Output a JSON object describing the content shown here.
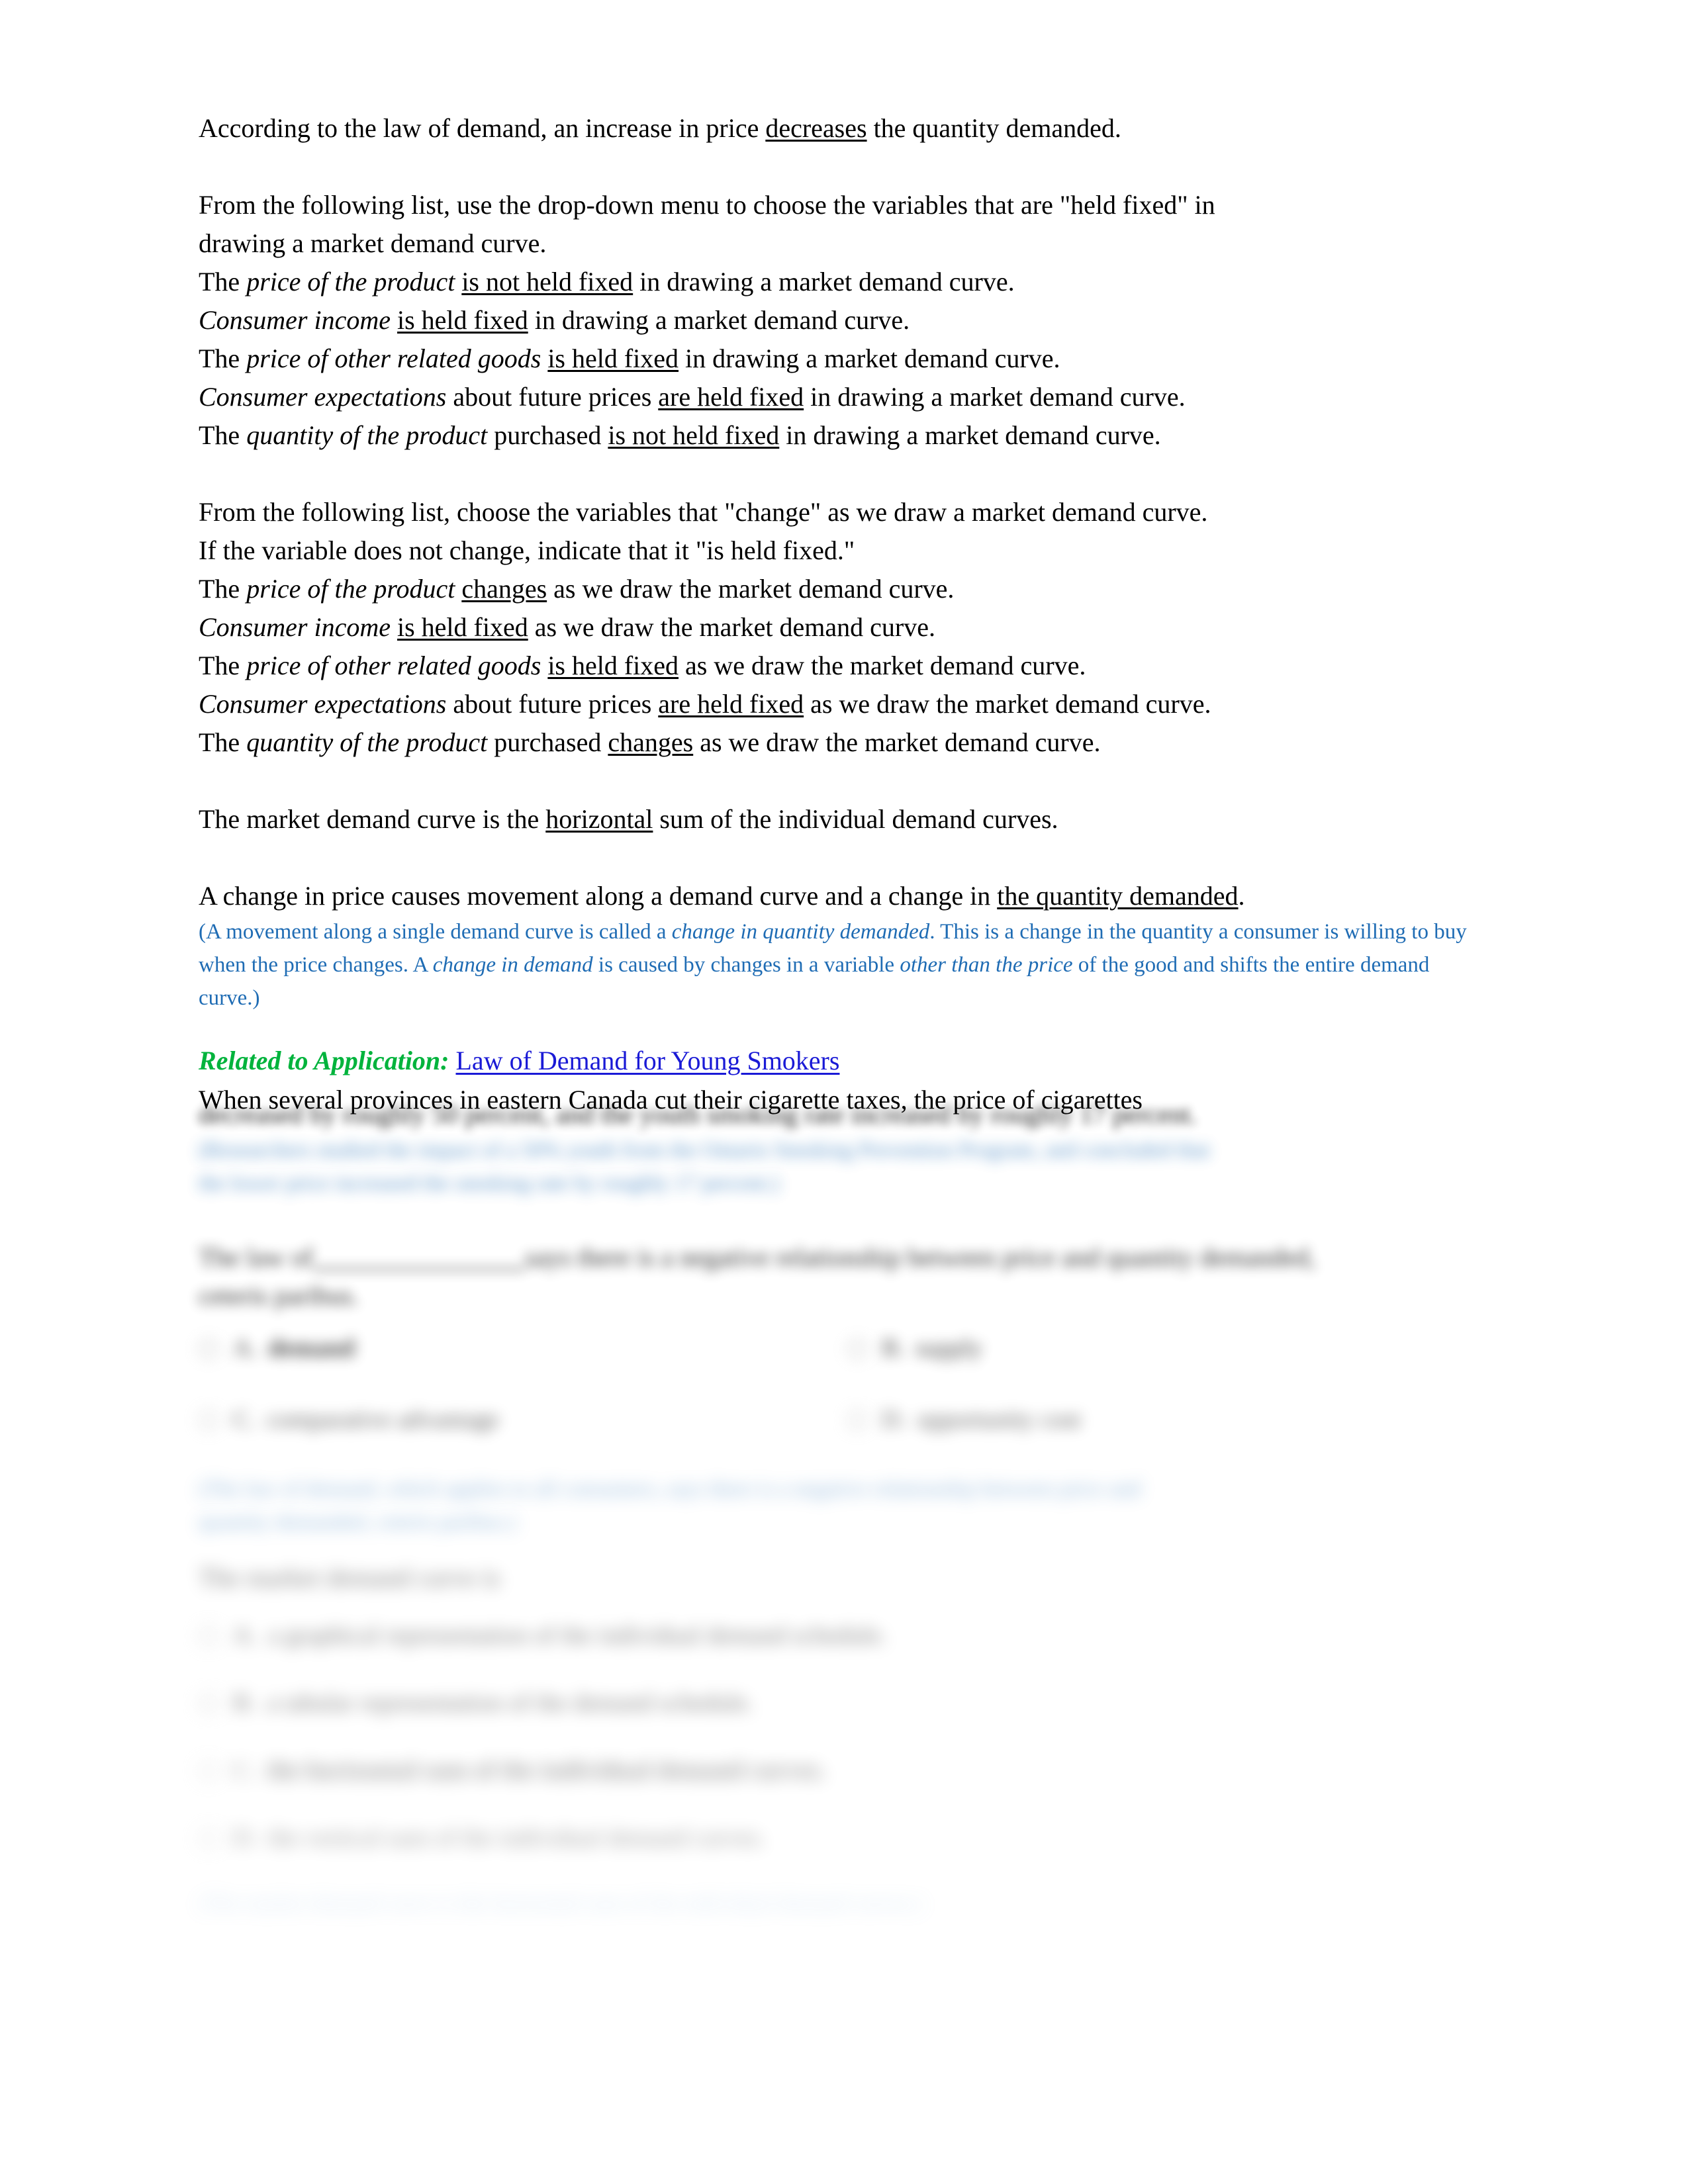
{
  "document": {
    "intro_line": {
      "prefix": "According to the law of demand, an increase in price ",
      "answer": "decreases",
      "suffix": " the quantity demanded."
    },
    "section_held_fixed": {
      "prompt_line1": "From the following list, use the drop-down menu to choose the variables that are \"held fixed\" in",
      "prompt_line2": "drawing a market demand curve.",
      "items": [
        {
          "lead": "The ",
          "variable": "price of the product",
          "mid": " ",
          "answer": "is not held fixed",
          "tail": " in drawing a market demand curve."
        },
        {
          "lead": "",
          "variable": "Consumer income",
          "mid": " ",
          "answer": "is held fixed",
          "tail": " in drawing a market demand curve."
        },
        {
          "lead": "The ",
          "variable": "price of other related goods",
          "mid": " ",
          "answer": "is held fixed",
          "tail": " in drawing a market demand curve."
        },
        {
          "lead": "",
          "variable": "Consumer expectations",
          "mid": " about future prices ",
          "answer": "are held fixed",
          "tail": " in drawing a market demand curve."
        },
        {
          "lead": "The ",
          "variable": "quantity of the product",
          "mid": " purchased ",
          "answer": "is not held fixed",
          "tail": " in drawing a market demand curve."
        }
      ]
    },
    "section_changes": {
      "prompt_line1": "From the following list, choose the variables that \"change\" as we draw a market demand curve.",
      "prompt_line2": "If the variable does not change, indicate that it \"is held fixed.\"",
      "items": [
        {
          "lead": "The ",
          "variable": "price of the product",
          "mid": " ",
          "answer": "changes",
          "tail": " as we draw the market demand curve."
        },
        {
          "lead": "",
          "variable": "Consumer income",
          "mid": " ",
          "answer": "is held fixed",
          "tail": " as we draw the market demand curve."
        },
        {
          "lead": "The ",
          "variable": "price of other related goods",
          "mid": " ",
          "answer": "is held fixed",
          "tail": " as we draw the market demand curve."
        },
        {
          "lead": "",
          "variable": "Consumer expectations",
          "mid": " about future prices ",
          "answer": "are held fixed",
          "tail": " as we draw the market demand curve."
        },
        {
          "lead": "The ",
          "variable": "quantity of the product",
          "mid": " purchased ",
          "answer": "changes",
          "tail": " as we draw the market demand curve."
        }
      ]
    },
    "market_curve_line": {
      "prefix": "The market demand curve is the ",
      "answer": "horizontal",
      "suffix": " sum of the individual demand curves."
    },
    "movement_line": {
      "prefix": "A change in price causes movement along a demand curve and a change in ",
      "answer": "the quantity demanded",
      "suffix": "."
    },
    "movement_explanation": {
      "part1": "(A movement along a single demand curve is called a ",
      "italic1": "change in quantity demanded",
      "part2": ". This is a change in the quantity a consumer is willing to buy when the price changes. A ",
      "italic2": "change in demand",
      "part3": " is caused by changes in a variable ",
      "italic3": "other than the price",
      "part4": " of the good and shifts the entire demand curve.)"
    },
    "application": {
      "label": "Related to Application:",
      "link": "Law of Demand for Young Smokers",
      "body_line1": "When several provinces in eastern Canada cut their cigarette taxes, the price of cigarettes",
      "body_line2": "decreased by roughly 50 percent, and the youth smoking rate increased by roughly 17 percent."
    },
    "application_note": {
      "line1": "(Researchers studied the impact of a 50% youth from the Ontario Smoking Prevention Program, and concluded that",
      "line2": "the lower price increased the smoking rate by roughly 17 percent.)"
    },
    "question_1": {
      "stem_before_blank": "The law of",
      "stem_after_blank": "says there is a negative relationship between price and quantity demanded,",
      "stem_line2": "ceteris paribus.",
      "options": [
        {
          "letter": "A.",
          "text": "demand",
          "selected": true
        },
        {
          "letter": "B.",
          "text": "supply",
          "selected": false
        },
        {
          "letter": "C.",
          "text": "comparative advantage",
          "selected": false
        },
        {
          "letter": "D.",
          "text": "opportunity cost",
          "selected": false
        }
      ],
      "explanation_line1": "(The law of demand, which applies to all consumers, says there is a negative relationship between price and",
      "explanation_line2": "quantity demanded, ceteris paribus.)"
    },
    "question_2": {
      "stem": "The market demand curve is",
      "options": [
        {
          "letter": "A.",
          "text": "a graphical representation of the individual demand schedule.",
          "selected": false
        },
        {
          "letter": "B.",
          "text": "a tabular representation of the demand schedule.",
          "selected": false
        },
        {
          "letter": "C.",
          "text": "the horizontal sum of the individual demand curves.",
          "selected": true
        },
        {
          "letter": "D.",
          "text": "the vertical sum of the individual demand curves.",
          "selected": false
        }
      ],
      "explanation": "(The market demand curve is the horizontal sum of the individual demand curves.)"
    },
    "colors": {
      "body": "#000000",
      "blue_note": "#1f6cb4",
      "green_label": "#00b33c",
      "link_blue": "#1a1ad6",
      "page_background": "#ffffff"
    }
  }
}
